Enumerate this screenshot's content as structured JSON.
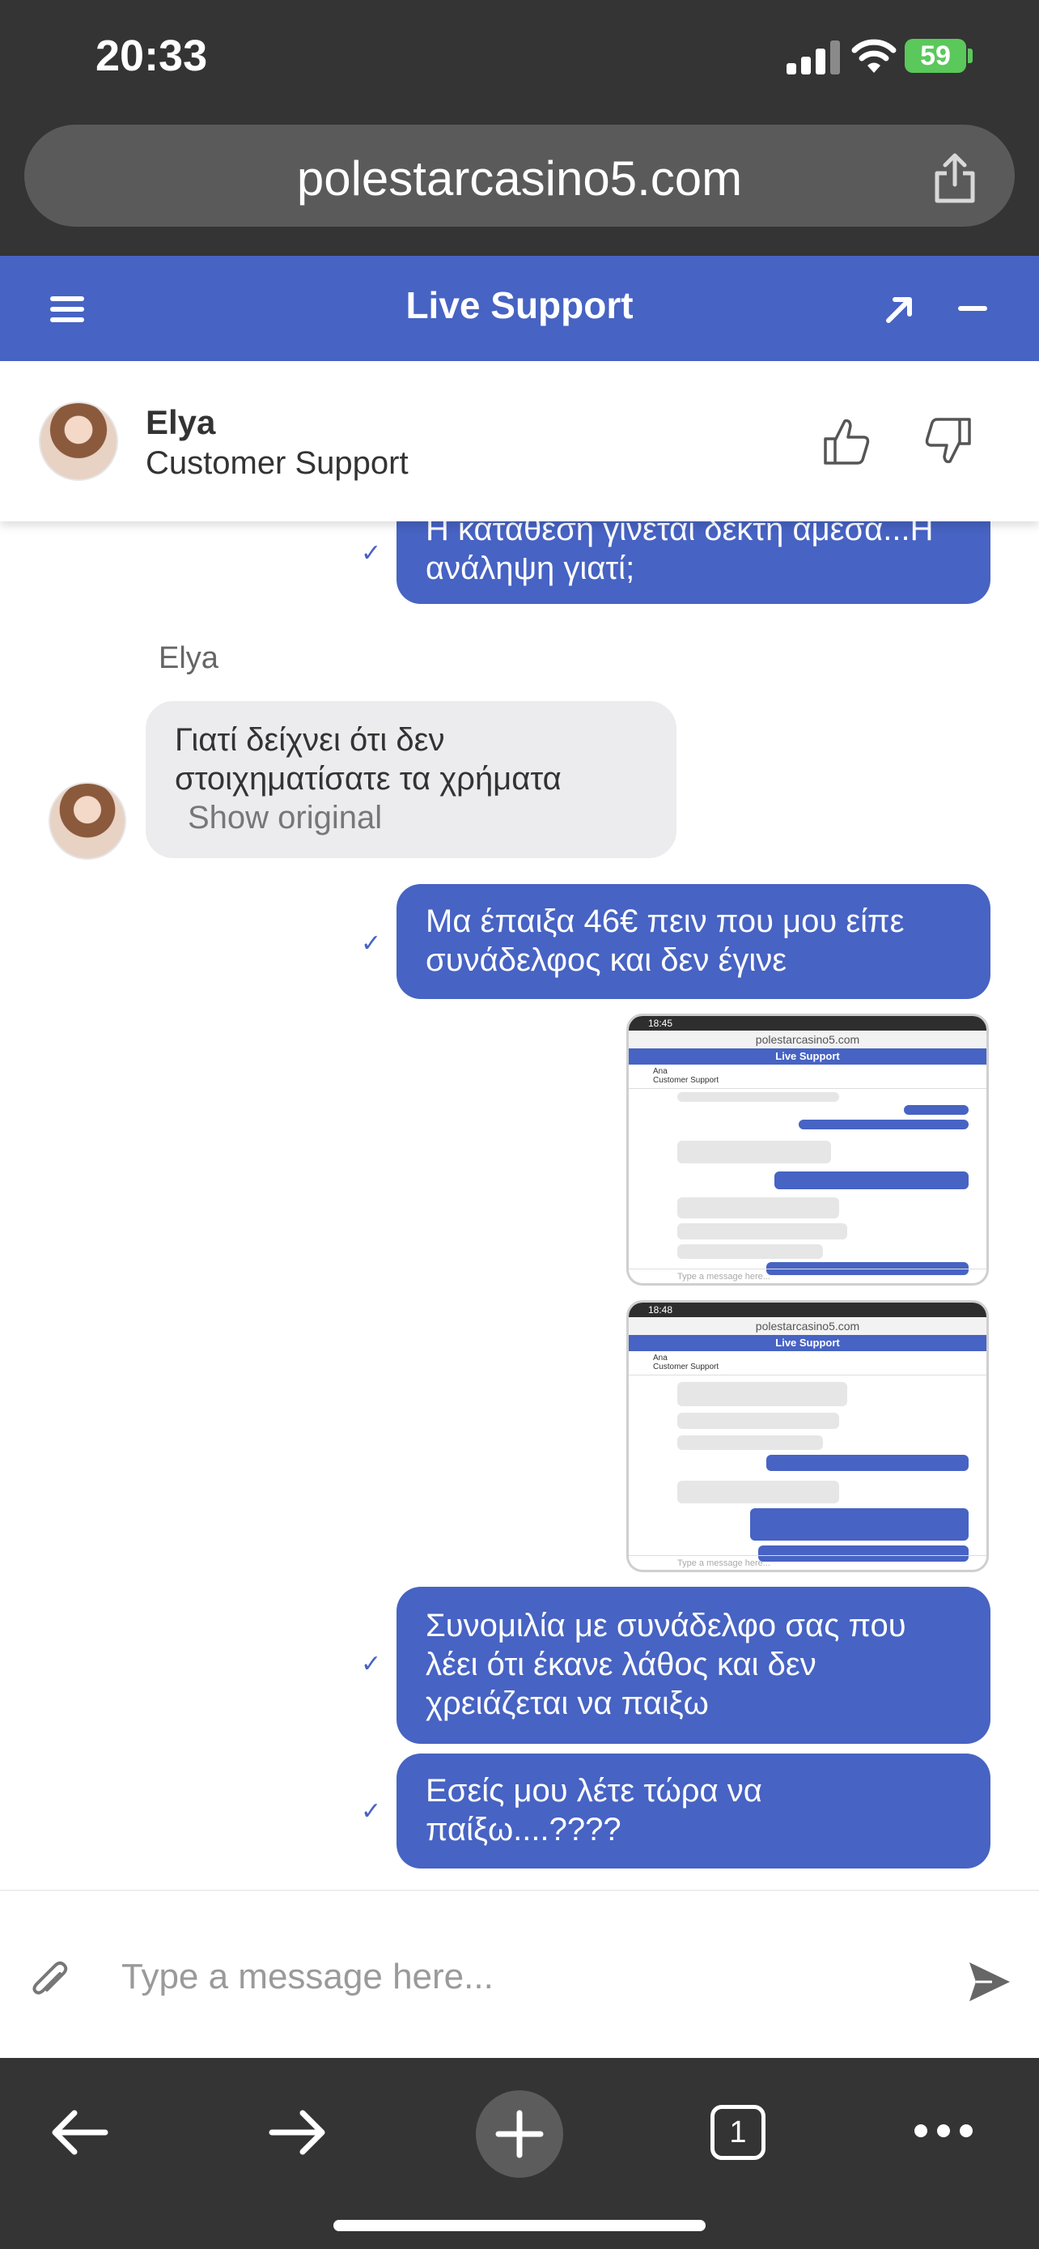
{
  "status_bar": {
    "time": "20:33",
    "battery": "59"
  },
  "browser": {
    "url": "polestarcasino5.com"
  },
  "chat_header": {
    "title": "Live Support"
  },
  "agent": {
    "name": "Elya",
    "role": "Customer Support"
  },
  "messages": {
    "m1": "Η κατάθεση γίνεται δεκτή άμεσα...Η ανάληψη γιατί;",
    "sender": "Elya",
    "m2": "Γιατί δείχνει ότι δεν στοιχηματίσατε τα χρήματα",
    "show_original": "Show original",
    "m3": "Μα έπαιξα 46€ πειν που μου είπε συνάδελφος και δεν έγινε",
    "m4": "Συνομιλία με συνάδελφο σας που λέει ότι έκανε λάθος και δεν χρειάζεται να παιξω",
    "m5": "Εσείς μου λέτε τώρα να παίξω....????"
  },
  "screenshots": [
    {
      "time": "18:45",
      "url": "polestarcasino5.com",
      "header": "Live Support",
      "agent_name": "Ana",
      "agent_role": "Customer Support",
      "input_placeholder": "Type a message here..."
    },
    {
      "time": "18:48",
      "url": "polestarcasino5.com",
      "header": "Live Support",
      "agent_name": "Ana",
      "agent_role": "Customer Support",
      "input_placeholder": "Type a message here..."
    }
  ],
  "composer": {
    "placeholder": "Type a message here..."
  },
  "toolbar": {
    "tabs_count": "1"
  },
  "colors": {
    "accent": "#4763c3",
    "dark_chrome": "#343434",
    "incoming_bubble": "#ececee",
    "battery": "#5ac85a"
  }
}
